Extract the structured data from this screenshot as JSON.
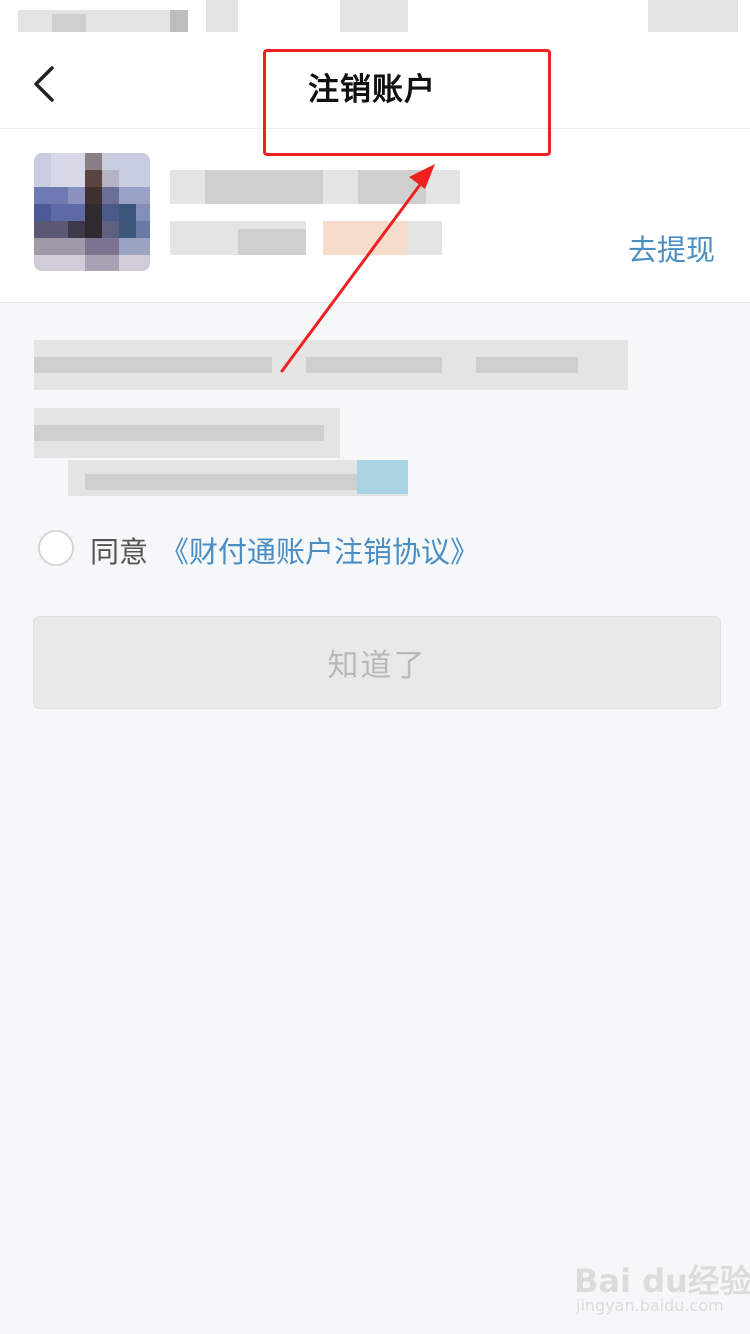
{
  "header": {
    "title": "注销账户",
    "back_icon": "chevron-left-icon"
  },
  "account": {
    "withdraw_label": "去提现"
  },
  "agreement": {
    "agree_label": "同意",
    "link_label": "《财付通账户注销协议》"
  },
  "actions": {
    "ok_label": "知道了"
  },
  "watermark": {
    "logo": "Bai du经验",
    "url": "jingyan.baidu.com"
  },
  "colors": {
    "accent": "#4a8ec4",
    "annotation": "#f02020",
    "background": "#f6f7f9"
  }
}
